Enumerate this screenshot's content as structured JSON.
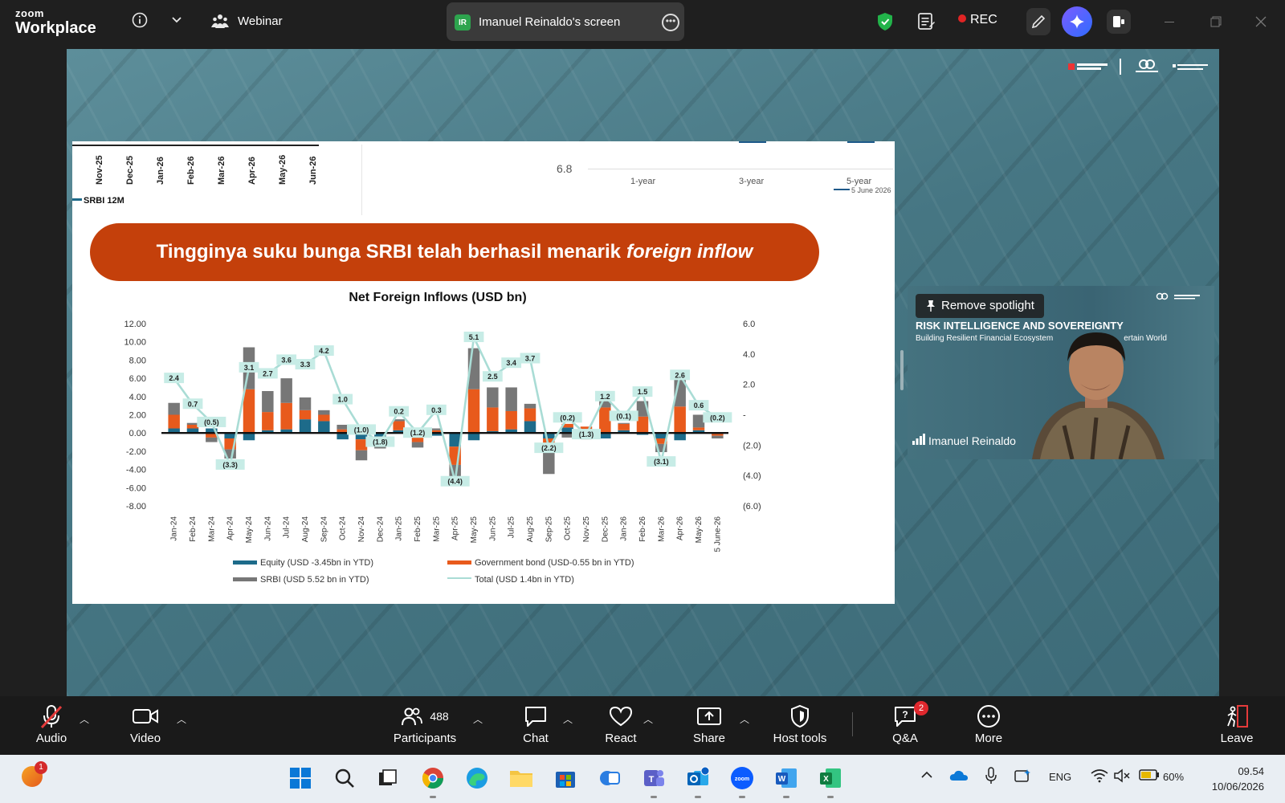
{
  "topbar": {
    "logo_line1": "zoom",
    "logo_line2": "Workplace",
    "webinar_label": "Webinar",
    "share_badge": "IR",
    "share_title": "Imanuel Reinaldo's screen",
    "rec_label": "REC"
  },
  "slide": {
    "strip_months": [
      "Nov-25",
      "Dec-25",
      "Jan-26",
      "Feb-26",
      "Mar-26",
      "Apr-26",
      "May-26",
      "Jun-26"
    ],
    "srbi12_label": "SRBI 12M",
    "yield_value_label": "6.8",
    "yield_x_labels": [
      "1-year",
      "3-year",
      "5-year"
    ],
    "yield_legend": "5 June 2026",
    "banner_text": "Tingginya suku bunga SRBI telah berhasil menarik",
    "banner_italic": "foreign inflow"
  },
  "chart_data": {
    "type": "bar",
    "stacked": true,
    "title": "Net Foreign Inflows  (USD bn)",
    "categories": [
      "Jan-24",
      "Feb-24",
      "Mar-24",
      "Apr-24",
      "May-24",
      "Jun-24",
      "Jul-24",
      "Aug-24",
      "Sep-24",
      "Oct-24",
      "Nov-24",
      "Dec-24",
      "Jan-25",
      "Feb-25",
      "Mar-25",
      "Apr-25",
      "May-25",
      "Jun-25",
      "Jul-25",
      "Aug-25",
      "Sep-25",
      "Oct-25",
      "Nov-25",
      "Dec-25",
      "Jan-26",
      "Feb-26",
      "Mar-26",
      "Apr-26",
      "May-26",
      "5 June-26"
    ],
    "left_axis": {
      "ylim": [
        -8,
        12
      ],
      "ticks": [
        "12.00",
        "10.00",
        "8.00",
        "6.00",
        "4.00",
        "2.00",
        "0.00",
        "-2.00",
        "-4.00",
        "-6.00",
        "-8.00"
      ]
    },
    "right_axis": {
      "ylim": [
        -6,
        6
      ],
      "ticks": [
        "6.0",
        "4.0",
        "2.0",
        "-",
        "(2.0)",
        "(4.0)",
        "(6.0)"
      ]
    },
    "colors": {
      "equity": "#1d6b8a",
      "govbond": "#e85a1c",
      "srbi": "#777777",
      "total": "#a9dcd5",
      "label_box": "#c7ece6"
    },
    "series": [
      {
        "name": "Equity (USD -3.45bn in YTD)",
        "key": "equity",
        "values": [
          0.5,
          0.5,
          0.5,
          -0.6,
          -0.8,
          0.3,
          0.4,
          1.5,
          1.3,
          -0.7,
          -0.7,
          -0.4,
          0.3,
          -0.5,
          -0.3,
          -1.5,
          -0.8,
          0.2,
          0.4,
          1.3,
          -0.6,
          0.6,
          -0.5,
          -0.6,
          0.3,
          -0.2,
          -0.6,
          -0.8,
          0.3,
          -0.1
        ]
      },
      {
        "name": "Government bond (USD-0.55 bn in YTD)",
        "key": "govbond",
        "values": [
          1.5,
          0.4,
          -0.5,
          -1.2,
          4.8,
          2.0,
          2.9,
          1.0,
          0.7,
          0.4,
          -1.2,
          -0.5,
          1.0,
          -0.5,
          0.3,
          -2.0,
          4.8,
          2.6,
          2.0,
          1.4,
          -0.8,
          0.4,
          0.7,
          2.8,
          0.7,
          1.8,
          -0.6,
          2.9,
          0.3,
          -0.2
        ]
      },
      {
        "name": "SRBI (USD 5.52 bn in YTD)",
        "key": "srbi",
        "values": [
          1.3,
          0.2,
          -0.5,
          -1.0,
          4.6,
          2.3,
          2.7,
          1.4,
          0.5,
          0.5,
          -1.1,
          -0.8,
          0.2,
          -0.6,
          0.2,
          -1.3,
          4.5,
          2.2,
          2.6,
          0.5,
          -3.1,
          -0.5,
          -0.2,
          1.3,
          0.1,
          1.7,
          -0.9,
          3.0,
          1.4,
          -0.3
        ]
      },
      {
        "name": "Total (USD 1.4bn in YTD)",
        "key": "total",
        "values": [
          2.4,
          0.7,
          -0.5,
          -3.3,
          3.1,
          2.7,
          3.6,
          3.3,
          4.2,
          1.0,
          -1.0,
          -1.8,
          0.2,
          -1.2,
          0.3,
          -4.4,
          5.1,
          2.5,
          3.4,
          3.7,
          -2.2,
          -0.2,
          -1.3,
          1.2,
          -0.1,
          1.5,
          -3.1,
          2.6,
          0.6,
          -0.2
        ],
        "data_labels": [
          "2.4",
          "0.7",
          "(0.5)",
          "(3.3)",
          "3.1",
          "2.7",
          "3.6",
          "3.3",
          "4.2",
          "1.0",
          "(1.0)",
          "(1.8)",
          "0.2",
          "(1.2)",
          "0.3",
          "(4.4)",
          "5.1",
          "2.5",
          "3.4",
          "3.7",
          "(2.2)",
          "(0.2)",
          "(1.3)",
          "1.2",
          "(0.1)",
          "1.5",
          "(3.1)",
          "2.6",
          "0.6",
          "(0.2)"
        ]
      }
    ],
    "legend": [
      "Equity (USD -3.45bn in YTD)",
      "Government bond (USD-0.55 bn in YTD)",
      "SRBI (USD 5.52 bn in YTD)",
      "Total (USD 1.4bn in YTD)"
    ],
    "legend_position": "bottom",
    "grid": false
  },
  "speaker": {
    "spotlight_label": "Remove spotlight",
    "event_title": "RISK INTELLIGENCE AND SOVEREIGNTY",
    "event_sub": "Building Resilient Financial Ecosystem",
    "event_sub2": "ertain World",
    "name": "Imanuel Reinaldo"
  },
  "toolbar": {
    "audio": "Audio",
    "video": "Video",
    "participants": "Participants",
    "participants_count": "488",
    "chat": "Chat",
    "react": "React",
    "share": "Share",
    "host_tools": "Host tools",
    "qa": "Q&A",
    "qa_badge": "2",
    "more": "More",
    "leave": "Leave"
  },
  "taskbar": {
    "notif_badge": "1",
    "lang": "ENG",
    "battery": "60%",
    "time": "09.54",
    "date": "10/06/2026"
  }
}
